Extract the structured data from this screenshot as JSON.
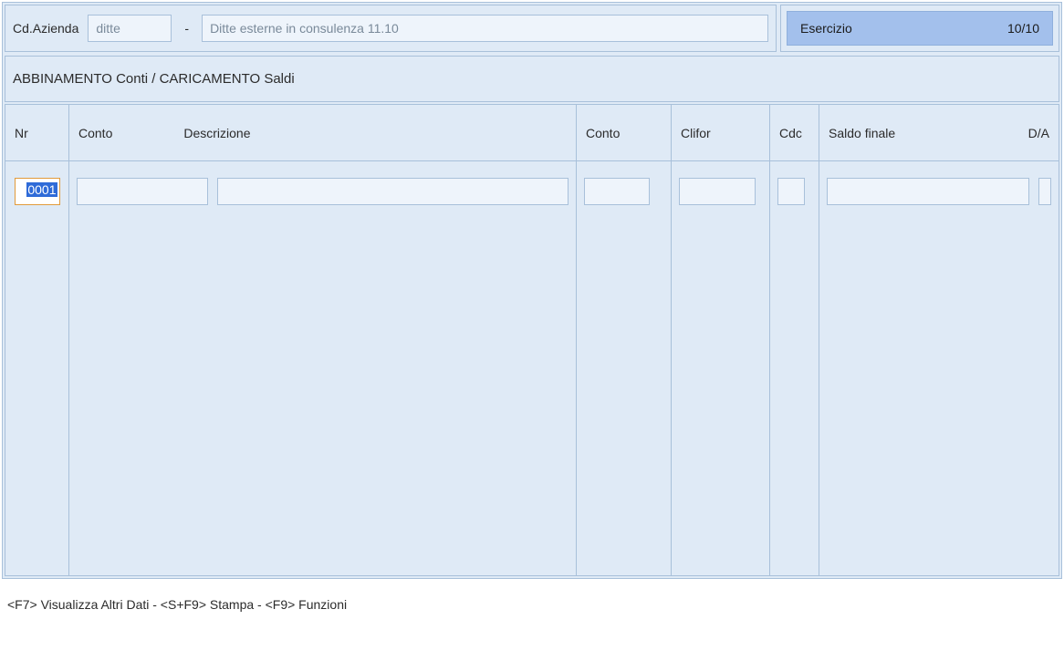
{
  "header": {
    "cd_azienda_label": "Cd.Azienda",
    "cd_azienda_value": "ditte",
    "separator": "-",
    "azienda_desc": "Ditte esterne in consulenza 11.10",
    "esercizio_label": "Esercizio",
    "esercizio_value": "10/10"
  },
  "section_title": "ABBINAMENTO Conti / CARICAMENTO Saldi",
  "columns": {
    "nr": "Nr",
    "conto": "Conto",
    "descrizione": "Descrizione",
    "conto2": "Conto",
    "clifor": "Clifor",
    "cdc": "Cdc",
    "saldo_finale": "Saldo finale",
    "da": "D/A"
  },
  "rows": [
    {
      "nr": "0001",
      "conto": "",
      "descrizione": "",
      "conto2": "",
      "clifor": "",
      "cdc": "",
      "saldo_finale": "",
      "da": ""
    }
  ],
  "footer_hint": "<F7> Visualizza Altri Dati - <S+F9> Stampa - <F9> Funzioni"
}
